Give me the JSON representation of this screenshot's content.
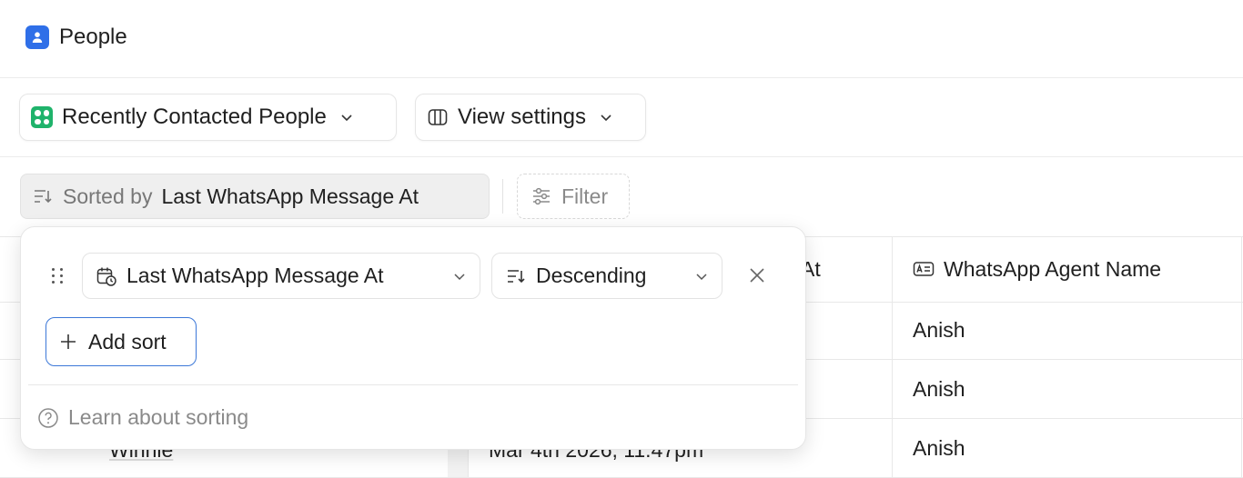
{
  "header": {
    "title": "People"
  },
  "view_bar": {
    "view_name": "Recently Contacted People",
    "settings_label": "View settings"
  },
  "sort_bar": {
    "prefix": "Sorted by",
    "field": "Last WhatsApp Message At",
    "filter_label": "Filter"
  },
  "table": {
    "partial_header": "At",
    "agent_header": "WhatsApp Agent Name",
    "rows": [
      {
        "name": "",
        "date": "",
        "agent": "Anish"
      },
      {
        "name": "",
        "date": "",
        "agent": "Anish"
      },
      {
        "name": "Winnie",
        "date": "Mar 4th 2026, 11:47pm",
        "agent": "Anish"
      }
    ]
  },
  "sort_popover": {
    "field_select": "Last WhatsApp Message At",
    "direction_select": "Descending",
    "add_sort_label": "Add sort",
    "learn_label": "Learn about sorting"
  },
  "colors": {
    "people_icon": "#2f6fe8",
    "view_icon": "#1fb36b",
    "add_sort_border": "#3c78d8"
  }
}
